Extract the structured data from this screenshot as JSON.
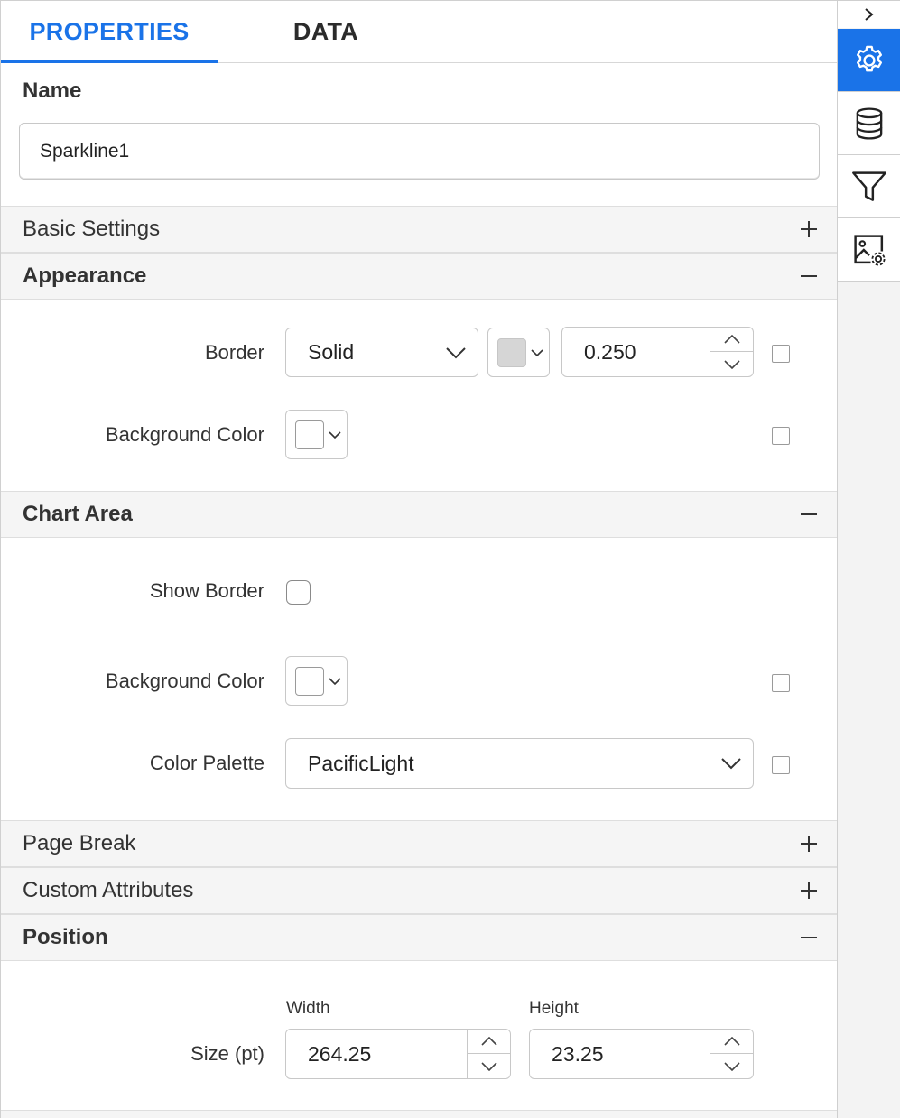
{
  "tabs": [
    {
      "label": "PROPERTIES",
      "active": true
    },
    {
      "label": "DATA",
      "active": false
    }
  ],
  "name_section": {
    "label": "Name",
    "value": "Sparkline1"
  },
  "sections": {
    "basic_settings": {
      "title": "Basic Settings",
      "expanded": false
    },
    "appearance": {
      "title": "Appearance",
      "expanded": true
    },
    "chart_area": {
      "title": "Chart Area",
      "expanded": true
    },
    "page_break": {
      "title": "Page Break",
      "expanded": false
    },
    "custom_attributes": {
      "title": "Custom Attributes",
      "expanded": false
    },
    "position": {
      "title": "Position",
      "expanded": true
    }
  },
  "appearance": {
    "border_label": "Border",
    "border_style": "Solid",
    "border_color": "#d6d6d6",
    "border_width": "0.250",
    "background_label": "Background Color",
    "background_color": "#ffffff"
  },
  "chart_area": {
    "show_border_label": "Show Border",
    "show_border_checked": false,
    "background_label": "Background Color",
    "background_color": "#ffffff",
    "palette_label": "Color Palette",
    "palette_value": "PacificLight"
  },
  "position": {
    "size_label": "Size (pt)",
    "width_caption": "Width",
    "width_value": "264.25",
    "height_caption": "Height",
    "height_value": "23.25"
  },
  "rail": {
    "items": [
      {
        "icon": "gear-icon",
        "active": true
      },
      {
        "icon": "database-icon",
        "active": false
      },
      {
        "icon": "filter-icon",
        "active": false
      },
      {
        "icon": "image-settings-icon",
        "active": false
      }
    ]
  },
  "colors": {
    "accent": "#1a73e8",
    "header_bg": "#f5f5f5"
  }
}
